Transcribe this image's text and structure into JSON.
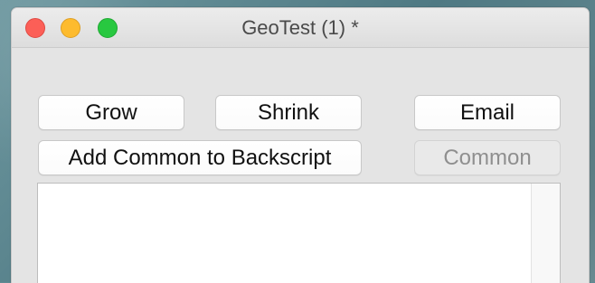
{
  "window": {
    "title": "GeoTest (1) *"
  },
  "buttons": {
    "grow": "Grow",
    "shrink": "Shrink",
    "email": "Email",
    "add_common": "Add Common to Backscript",
    "common": "Common"
  },
  "text_area": {
    "value": ""
  },
  "colors": {
    "close": "#fc5f57",
    "minimize": "#fdbb2e",
    "zoom": "#28c840",
    "window_bg": "#e4e4e4",
    "text_area_bg": "#ffffff"
  },
  "icons": {
    "close": "close-window-icon",
    "minimize": "minimize-window-icon",
    "zoom": "zoom-window-icon"
  }
}
